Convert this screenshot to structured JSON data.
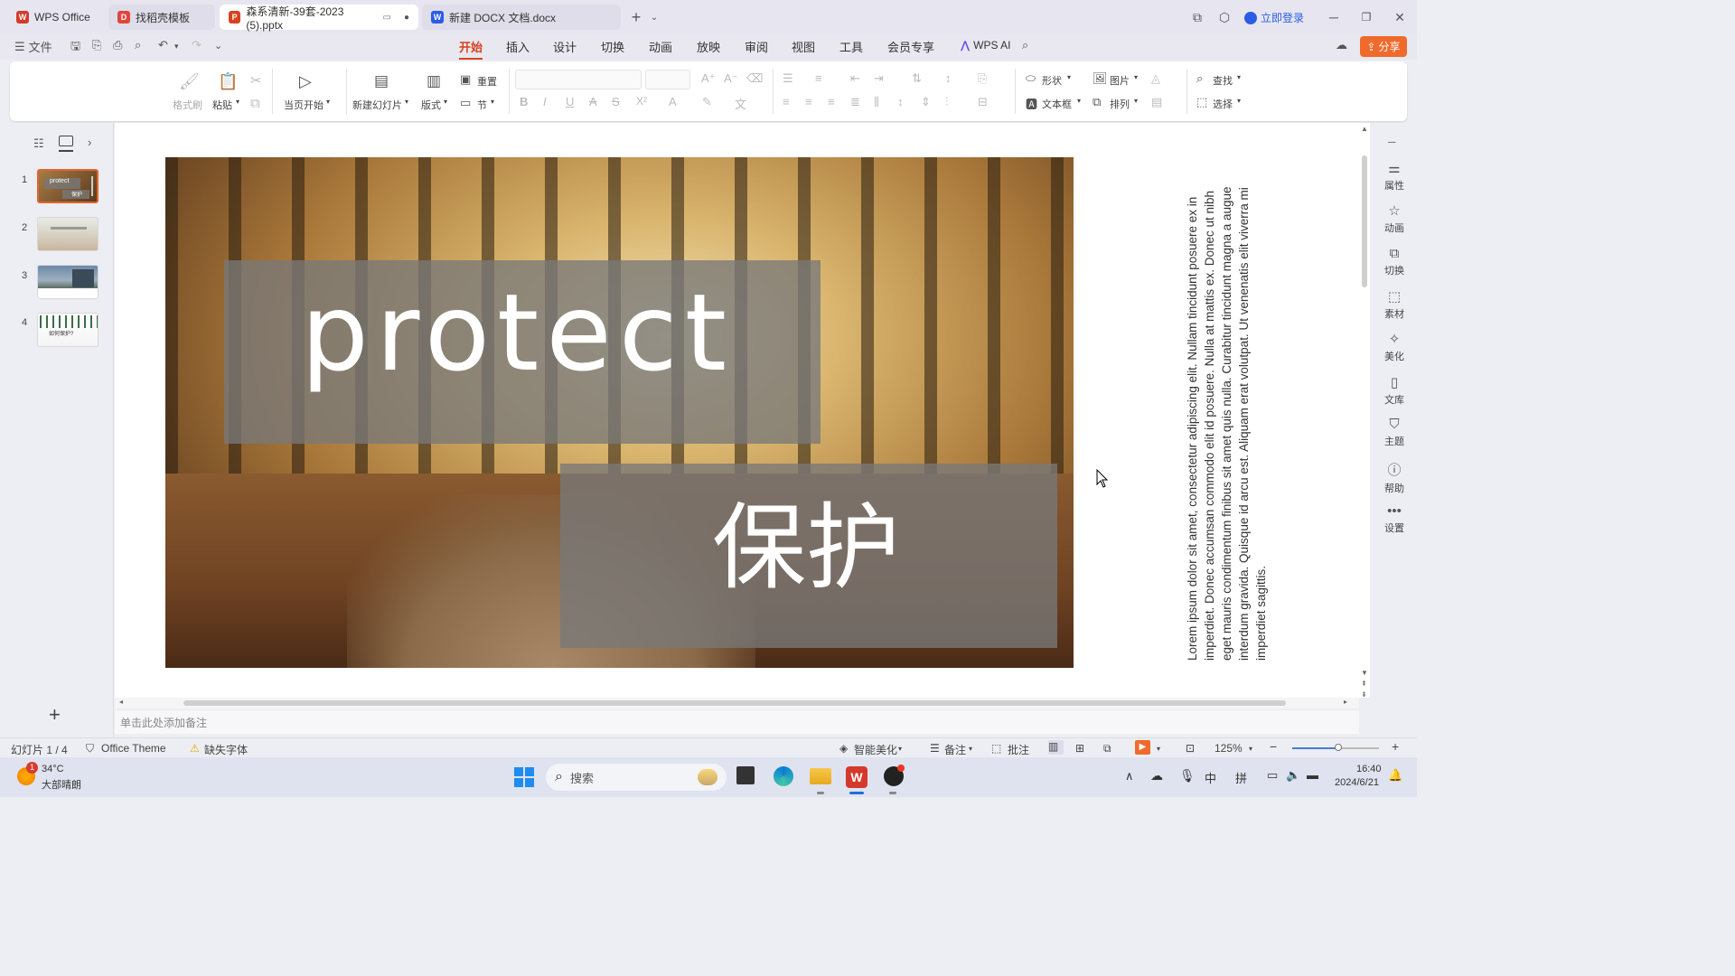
{
  "titlebar": {
    "tabs": [
      {
        "label": "WPS Office"
      },
      {
        "label": "找稻壳模板"
      },
      {
        "label": "森系清新-39套-2023 (5).pptx"
      },
      {
        "label": "新建 DOCX 文档.docx"
      }
    ],
    "login_label": "立即登录"
  },
  "menubar": {
    "file_label": "文件",
    "items": [
      "开始",
      "插入",
      "设计",
      "切换",
      "动画",
      "放映",
      "审阅",
      "视图",
      "工具",
      "会员专享"
    ],
    "ai_label": "WPS AI",
    "share_label": "分享"
  },
  "ribbon": {
    "format_painter": "格式刷",
    "paste": "粘贴",
    "play_current": "当页开始",
    "new_slide": "新建幻灯片",
    "layout": "版式",
    "reset": "重置",
    "section": "节",
    "shape": "形状",
    "picture": "图片",
    "find": "查找",
    "textbox": "文本框",
    "arrange": "排列",
    "select": "选择"
  },
  "slides_panel": {
    "numbers": [
      "1",
      "2",
      "3",
      "4"
    ],
    "thumb1_text": "protect",
    "thumb1_sub": "保护",
    "thumb4_text": "如何保护?"
  },
  "slide": {
    "title_en": "protect",
    "title_cn": "保护"
  },
  "side_text": "Lorem ipsum dolor sit amet, consectetur adipiscing elit. Nullam tincidunt posuere ex in imperdiet. Donec accumsan commodo elit id posuere. Nulla at mattis ex. Donec ut nibh eget mauris condimentum finibus sit amet quis nulla. Curabitur tincidunt magna a augue interdum gravida. Quisque id arcu est. Aliquam erat volutpat. Ut venenatis elit viverra mi imperdiet sagittis.",
  "right_sidebar": [
    "属性",
    "动画",
    "切换",
    "素材",
    "美化",
    "文库",
    "主题",
    "帮助",
    "设置"
  ],
  "notes_placeholder": "单击此处添加备注",
  "statusbar": {
    "slide_count": "幻灯片 1 / 4",
    "theme": "Office Theme",
    "missing_font": "缺失字体",
    "smart_beautify": "智能美化",
    "notes": "备注",
    "comments": "批注",
    "zoom": "125%"
  },
  "taskbar": {
    "weather_temp": "34°C",
    "weather_desc": "大部晴朗",
    "weather_badge": "1",
    "search_label": "搜索",
    "ime_lang": "中",
    "ime_mode": "拼",
    "time": "16:40",
    "date": "2024/6/21"
  },
  "colors": {
    "accent": "#d9421e",
    "share_bg": "#f06a2c",
    "wps_red": "#d33a2c",
    "word_blue": "#2b5ce6"
  }
}
